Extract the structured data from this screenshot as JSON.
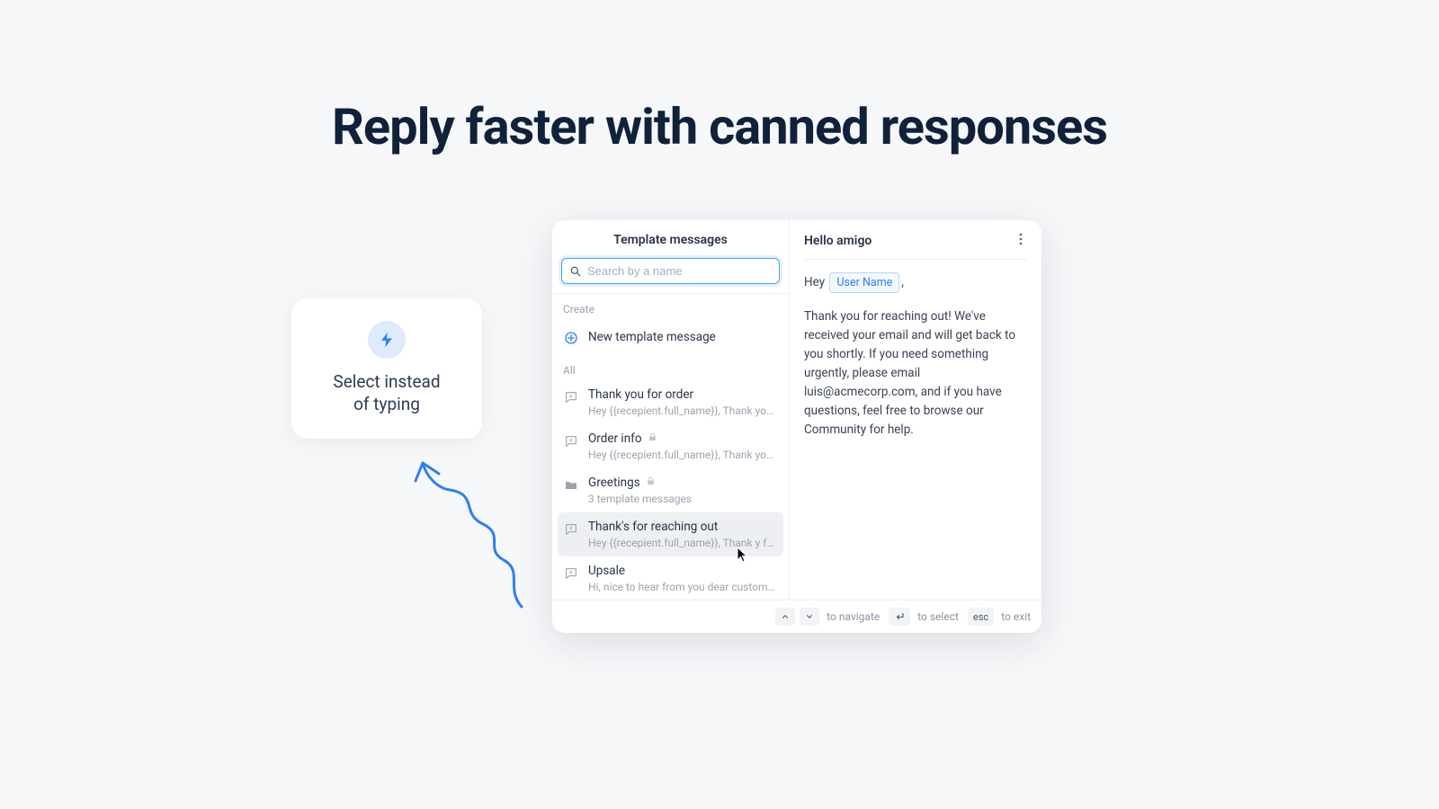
{
  "headline": "Reply faster with canned responses",
  "promo": {
    "line1": "Select instead",
    "line2": "of typing"
  },
  "modal": {
    "left_title": "Template messages",
    "search_placeholder": "Search by a name",
    "section_create": "Create",
    "create_label": "New template message",
    "section_all": "All",
    "items": [
      {
        "title": "Thank you for order",
        "sub": "Hey {{recepient.full_name}}, Thank you for yo...",
        "locked": false,
        "type": "msg"
      },
      {
        "title": "Order info",
        "sub": "Hey {{recepient.full_name}}, Thank you for yo...",
        "locked": true,
        "type": "msg"
      },
      {
        "title": "Greetings",
        "sub": "3 template messages",
        "locked": true,
        "type": "folder"
      },
      {
        "title": "Thank's for reaching out",
        "sub": "Hey {{recepient.full_name}}, Thank y    for yo...",
        "locked": false,
        "type": "msg",
        "selected": true
      },
      {
        "title": "Upsale",
        "sub": "Hi, nice to hear from you dear customer, how...",
        "locked": false,
        "type": "msg"
      }
    ]
  },
  "preview": {
    "title": "Hello amigo",
    "greet_prefix": "Hey",
    "chip": "User Name",
    "greet_suffix": ",",
    "body": "Thank you for reaching out! We've received your email and will get back to you shortly. If you need something urgently, please email luis@acmecorp.com, and if you have questions, feel free to browse our Community for help."
  },
  "footer": {
    "navigate": "to navigate",
    "select": "to select",
    "exit": "to exit",
    "esc": "esc"
  }
}
